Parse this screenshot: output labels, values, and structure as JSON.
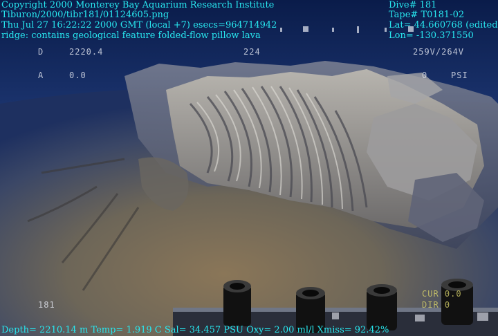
{
  "overlay": {
    "copyright": "Copyright 2000 Monterey Bay Aquarium Research Institute",
    "path": "Tiburon/2000/tibr181/01124605.png",
    "timestamp": "Thu Jul 27 16:22:22 2000 GMT (local +7)  esecs=964714942",
    "annotation": "ridge: contains geological feature folded-flow pillow lava",
    "dive": "Dive# 181",
    "tape": "Tape# T0181-02",
    "lat": "Lat= 44.660768 (edited)",
    "lon": "Lon= -130.371550",
    "depth_line": "Depth= 2210.14 m  Temp= 1.919 C  Sal= 34.457 PSU  Oxy= 2.00 ml/l  Xmiss= 92.42%"
  },
  "camera_osd": {
    "d_label": "D",
    "d_value": "2220.4",
    "heading": "224",
    "voltage": "259V/264V",
    "a_label": "A",
    "a_value": "0.0",
    "psi_value": "0",
    "psi_label": "PSI",
    "frame_counter": "181",
    "cur": "CUR 0.0",
    "dir": "DIR 0"
  }
}
